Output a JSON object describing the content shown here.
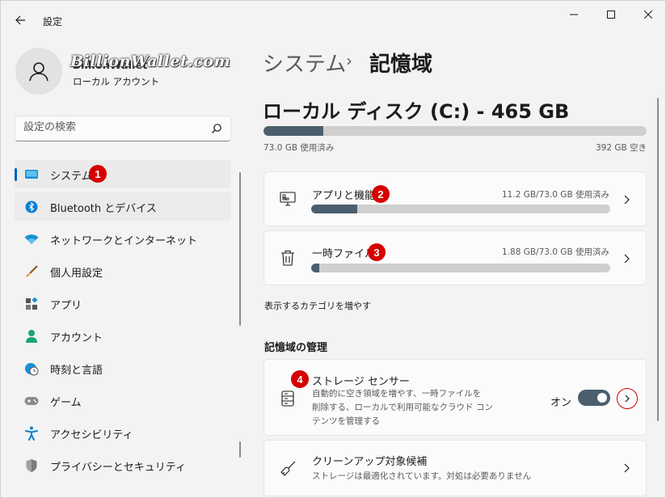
{
  "window": {
    "title": "設定"
  },
  "account": {
    "name": "BillionWallet",
    "type": "ローカル アカウント",
    "watermark": "BillionWallet.com"
  },
  "search": {
    "placeholder": "設定の検索"
  },
  "sidebar": {
    "items": [
      {
        "label": "システム",
        "icon": "monitor-icon"
      },
      {
        "label": "Bluetooth とデバイス",
        "icon": "bluetooth-icon"
      },
      {
        "label": "ネットワークとインターネット",
        "icon": "wifi-icon"
      },
      {
        "label": "個人用設定",
        "icon": "brush-icon"
      },
      {
        "label": "アプリ",
        "icon": "apps-icon"
      },
      {
        "label": "アカウント",
        "icon": "person-icon"
      },
      {
        "label": "時刻と言語",
        "icon": "globe-clock-icon"
      },
      {
        "label": "ゲーム",
        "icon": "gamepad-icon"
      },
      {
        "label": "アクセシビリティ",
        "icon": "accessibility-icon"
      },
      {
        "label": "プライバシーとセキュリティ",
        "icon": "shield-icon"
      }
    ]
  },
  "breadcrumb": {
    "parent": "システム",
    "separator": "›",
    "current": "記憶域"
  },
  "disk": {
    "title": "ローカル ディスク (C:) - 465 GB",
    "used_label": "73.0 GB 使用済み",
    "free_label": "392 GB 空き",
    "used_fraction": 0.157
  },
  "categories": [
    {
      "title": "アプリと機能",
      "size": "11.2 GB/73.0 GB 使用済み",
      "fraction": 0.153
    },
    {
      "title": "一時ファイル",
      "size": "1.88 GB/73.0 GB 使用済み",
      "fraction": 0.026
    }
  ],
  "more_categories": "表示するカテゴリを増やす",
  "management": {
    "heading": "記憶域の管理",
    "storage_sense": {
      "title": "ストレージ センサー",
      "desc": [
        "自動的に空き領域を増やす、一時ファイルを",
        "削除する、ローカルで利用可能なクラウド コン",
        "テンツを管理する"
      ],
      "toggle_label": "オン",
      "toggle_on": true
    },
    "cleanup": {
      "title": "クリーンアップ対象候補",
      "desc": "ストレージは最適化されています。対処は必要ありません"
    }
  },
  "badges": [
    "1",
    "2",
    "3",
    "4"
  ],
  "colors": {
    "accent": "#005fb8",
    "bar_fill": "#4a5e6d",
    "badge": "#d60000"
  }
}
